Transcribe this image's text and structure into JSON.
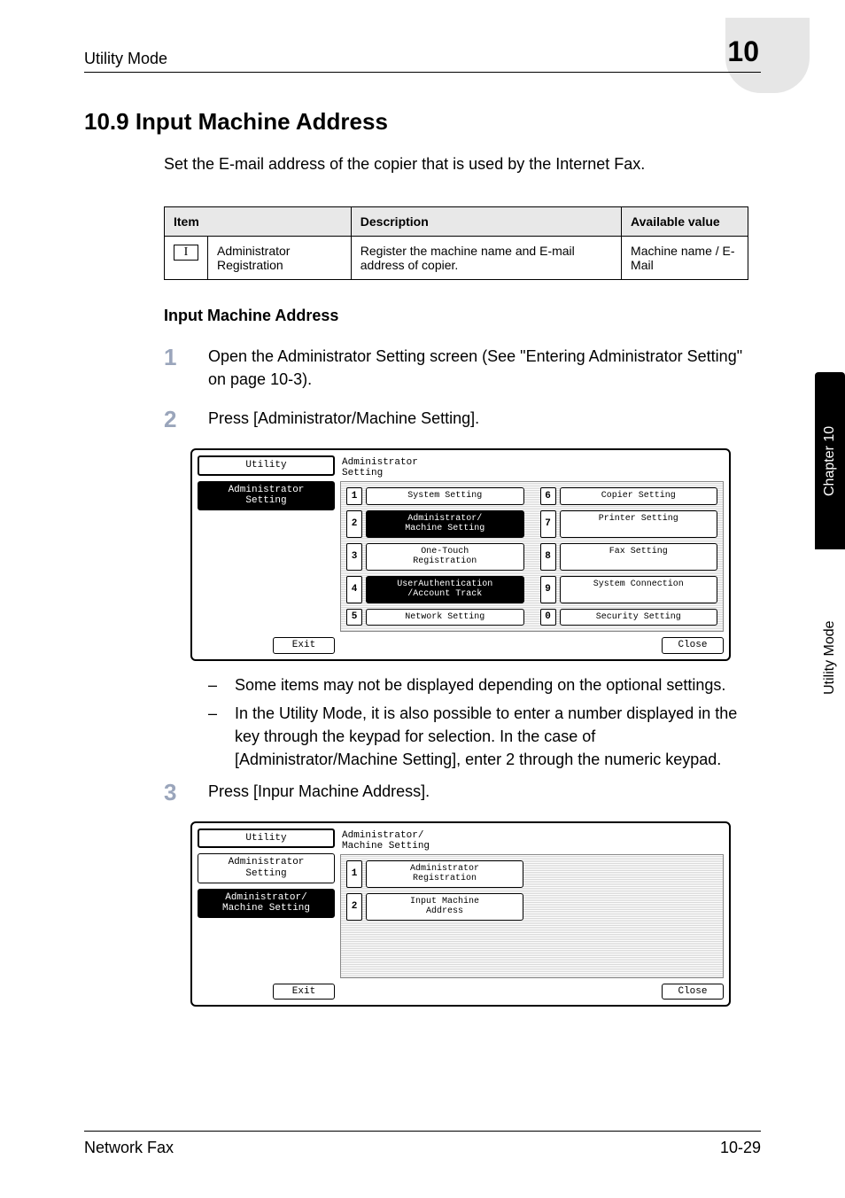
{
  "header": {
    "left": "Utility Mode",
    "right_number": "10"
  },
  "title": "10.9    Input Machine Address",
  "intro": "Set the E-mail address of the copier that is used by the Internet Fax.",
  "table": {
    "headers": [
      "Item",
      "Description",
      "Available value"
    ],
    "row": {
      "icon_letter": "I",
      "item": "Administrator Registration",
      "description": "Register the machine name and E-mail address of copier.",
      "available": "Machine name / E-Mail"
    }
  },
  "subhead": "Input Machine Address",
  "steps": {
    "s1": {
      "num": "1",
      "text": "Open the Administrator Setting screen (See \"Entering Administrator Setting\" on page 10-3)."
    },
    "s2": {
      "num": "2",
      "text": "Press [Administrator/Machine Setting]."
    },
    "s3": {
      "num": "3",
      "text": "Press [Inpur Machine Address]."
    }
  },
  "bullets": [
    "Some items may not be displayed depending on the optional settings.",
    "In the Utility Mode, it is also possible to enter a number displayed in the key through the keypad for selection. In the case of [Administrator/Machine Setting], enter 2 through the numeric keypad."
  ],
  "lcd1": {
    "title": "Utility",
    "side_item": "Administrator\nSetting",
    "right_head": "Administrator\nSetting",
    "exit": "Exit",
    "close": "Close",
    "grid": [
      {
        "n": "1",
        "label": "System Setting"
      },
      {
        "n": "6",
        "label": "Copier Setting"
      },
      {
        "n": "2",
        "label": "Administrator/\nMachine Setting",
        "dark": true
      },
      {
        "n": "7",
        "label": "Printer Setting"
      },
      {
        "n": "3",
        "label": "One-Touch\nRegistration"
      },
      {
        "n": "8",
        "label": "Fax Setting"
      },
      {
        "n": "4",
        "label": "UserAuthentication\n/Account Track",
        "dark": true
      },
      {
        "n": "9",
        "label": "System Connection"
      },
      {
        "n": "5",
        "label": "Network Setting"
      },
      {
        "n": "0",
        "label": "Security Setting"
      }
    ]
  },
  "lcd2": {
    "title": "Utility",
    "side_items": [
      {
        "label": "Administrator\nSetting"
      },
      {
        "label": "Administrator/\nMachine Setting",
        "dark": true
      }
    ],
    "right_head": "Administrator/\nMachine Setting",
    "exit": "Exit",
    "close": "Close",
    "grid": [
      {
        "n": "1",
        "label": "Administrator\nRegistration"
      },
      {
        "n": "2",
        "label": "Input Machine\nAddress"
      }
    ]
  },
  "sidetab": {
    "dark": "Chapter 10",
    "light": "Utility Mode"
  },
  "footer": {
    "left": "Network Fax",
    "right": "10-29"
  }
}
